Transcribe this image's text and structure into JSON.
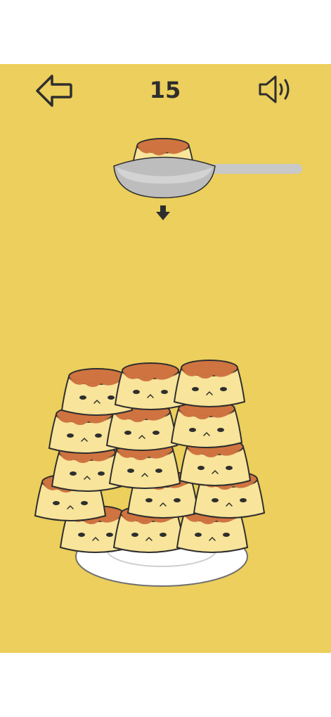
{
  "score": "15",
  "icons": {
    "back": "back-arrow-icon",
    "sound": "speaker-sound-icon",
    "drop": "down-arrow-icon"
  },
  "colors": {
    "background": "#ECCF5C",
    "pudding": "#F8E49A",
    "caramel": "#CF7440",
    "outline": "#2e2e2e",
    "plate": "#FFFFFF",
    "spoon": "#C8C8C8"
  },
  "pudding_stack_count": 15
}
